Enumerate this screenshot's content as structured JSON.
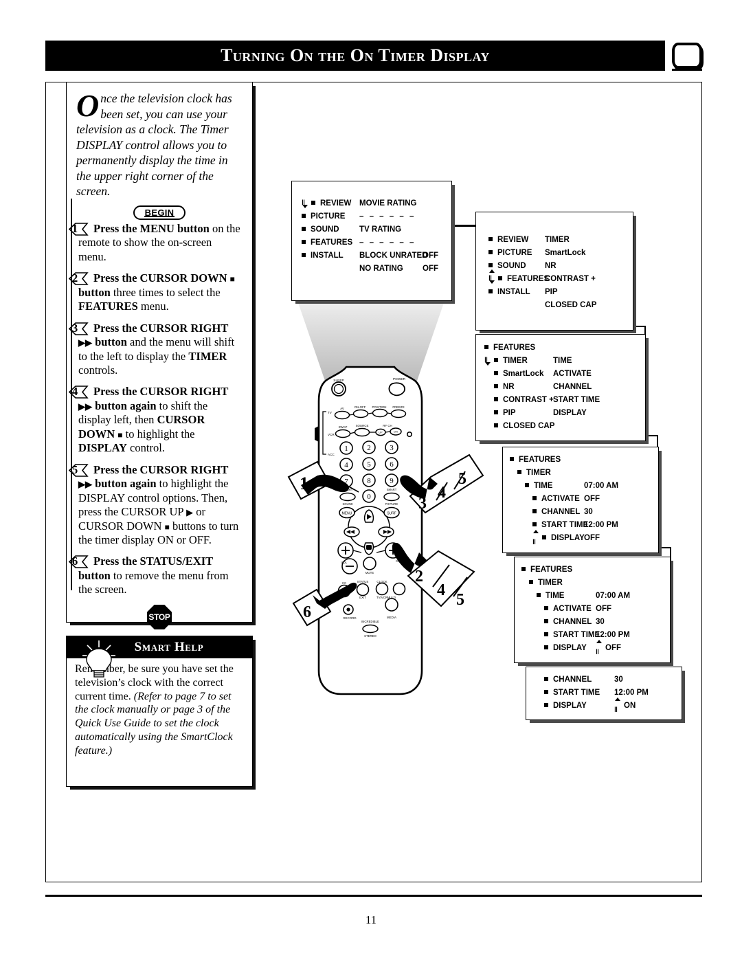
{
  "header": {
    "title": "Turning On the On Timer Display",
    "tv_icon": "tv-screen-icon"
  },
  "intro": {
    "dropcap": "O",
    "text": "nce the television clock has been set, you can use your television as a clock. The Timer DISPLAY control allows you to permanently display the time in the upper right corner of the screen."
  },
  "begin_label": "BEGIN",
  "stop_label": "STOP",
  "steps": [
    {
      "number": "1",
      "html": "<b>Press the MENU button</b> on the remote to show the on-screen menu."
    },
    {
      "number": "2",
      "html": "<b>Press the CURSOR DOWN <span class=\"sq\">■</span> button</b> three times to select the <b>FEATURES</b> menu."
    },
    {
      "number": "3",
      "html": "<b>Press the CURSOR RIGHT <span class=\"tri\">▶▶</span> button</b> and the menu will shift to the left to display the <b>TIMER</b> controls."
    },
    {
      "number": "4",
      "html": "<b>Press the CURSOR RIGHT <span class=\"tri\">▶▶</span> button again</b> to shift the display left, then <b>CURSOR DOWN <span class=\"sq\">■</span></b> to highlight the <b>DISPLAY</b> control."
    },
    {
      "number": "5",
      "html": "<b>Press the CURSOR RIGHT <span class=\"tri\">▶▶</span> button again</b> to highlight the DISPLAY control options. Then, press the CURSOR UP <span class=\"tri\">▶</span> or CURSOR DOWN <span class=\"sq\">■</span> buttons to turn the timer display ON or OFF."
    },
    {
      "number": "6",
      "html": "<b>Press the STATUS/EXIT button</b> to remove the menu from the screen."
    }
  ],
  "smart_help": {
    "title": "Smart Help",
    "body_html": "Remember, be sure you have set the television&rsquo;s clock with the correct current time. <span class=\"ital\">(Refer to page 7 to set the clock manually or page 3 of the Quick Use Guide to set the clock automatically using the SmartClock feature.)</span>"
  },
  "osd_panels": [
    {
      "id": "panel-1",
      "rows": [
        {
          "cursor": "down",
          "label": "REVIEW",
          "value": "MOVIE RATING",
          "value2": ""
        },
        {
          "cursor": "",
          "label": "PICTURE",
          "value": "– – – – – –",
          "value2": ""
        },
        {
          "cursor": "",
          "label": "SOUND",
          "value": "TV RATING",
          "value2": ""
        },
        {
          "cursor": "",
          "label": "FEATURES",
          "value": "– – – – – –",
          "value2": ""
        },
        {
          "cursor": "",
          "label": "INSTALL",
          "value": "BLOCK UNRATED",
          "value2": "OFF"
        },
        {
          "cursor": "",
          "label": "",
          "value": "NO RATING",
          "value2": "OFF"
        }
      ]
    },
    {
      "id": "panel-2",
      "rows": [
        {
          "cursor": "",
          "label": "REVIEW",
          "value": "TIMER"
        },
        {
          "cursor": "",
          "label": "PICTURE",
          "value": "SmartLock"
        },
        {
          "cursor": "",
          "label": "SOUND",
          "value": "NR"
        },
        {
          "cursor": "updown",
          "label": "FEATURES",
          "value": "CONTRAST +"
        },
        {
          "cursor": "",
          "label": "INSTALL",
          "value": "PIP"
        },
        {
          "cursor": "",
          "label": "",
          "value": "CLOSED CAP"
        }
      ]
    },
    {
      "id": "panel-3",
      "rows": [
        {
          "indent": 0,
          "cursor": "",
          "label": "FEATURES",
          "value": ""
        },
        {
          "indent": 0,
          "cursor": "down",
          "label": "TIMER",
          "value": "TIME"
        },
        {
          "indent": 1,
          "cursor": "",
          "label": "SmartLock",
          "value": "ACTIVATE"
        },
        {
          "indent": 1,
          "cursor": "",
          "label": "NR",
          "value": "CHANNEL"
        },
        {
          "indent": 1,
          "cursor": "",
          "label": "CONTRAST +",
          "value": "START TIME"
        },
        {
          "indent": 1,
          "cursor": "",
          "label": "PIP",
          "value": "DISPLAY"
        },
        {
          "indent": 1,
          "cursor": "",
          "label": "CLOSED CAP",
          "value": ""
        }
      ]
    },
    {
      "id": "panel-4",
      "rows": [
        {
          "indent": 0,
          "label": "FEATURES",
          "value": ""
        },
        {
          "indent": 1,
          "label": "TIMER",
          "value": ""
        },
        {
          "indent": 2,
          "label": "TIME",
          "value": "07:00 AM"
        },
        {
          "indent": 3,
          "label": "ACTIVATE",
          "value": "OFF"
        },
        {
          "indent": 3,
          "label": "CHANNEL",
          "value": "30"
        },
        {
          "indent": 3,
          "label": "START TIME",
          "value": "12:00 PM"
        },
        {
          "indent": 3,
          "label": "DISPLAY",
          "value": "OFF",
          "cursor": "up"
        }
      ]
    },
    {
      "id": "panel-5",
      "rows": [
        {
          "indent": 0,
          "label": "FEATURES",
          "value": ""
        },
        {
          "indent": 1,
          "label": "TIMER",
          "value": ""
        },
        {
          "indent": 2,
          "label": "TIME",
          "value": "07:00 AM"
        },
        {
          "indent": 3,
          "label": "ACTIVATE",
          "value": "OFF"
        },
        {
          "indent": 3,
          "label": "CHANNEL",
          "value": "30"
        },
        {
          "indent": 3,
          "label": "START TIME",
          "value": "12:00 PM"
        },
        {
          "indent": 3,
          "label": "DISPLAY",
          "value": "OFF",
          "value_cursor": true
        }
      ]
    },
    {
      "id": "panel-6",
      "rows": [
        {
          "indent": 0,
          "label": "CHANNEL",
          "value": "30"
        },
        {
          "indent": 0,
          "label": "START TIME",
          "value": "12:00 PM"
        },
        {
          "indent": 0,
          "label": "DISPLAY",
          "value": "ON",
          "value_cursor": true
        }
      ]
    }
  ],
  "remote": {
    "buttons": {
      "sleep": "SLEEP",
      "power": "POWER",
      "av": "AV",
      "onoff": "ON-OFF",
      "position": "POSITION",
      "freeze": "FREEZE",
      "swap": "SWAP",
      "source": "SOURCE",
      "rfch": "RF CH",
      "up": "UP",
      "dn": "DN",
      "tv": "TV",
      "vcr": "VCR",
      "acc": "ACC",
      "smart_sound": "SMART SOUND",
      "smart_picture": "SMART PICTURE",
      "menu": "MENU",
      "surf": "SURF",
      "vol": "VOL",
      "ch": "CH",
      "mute": "MUTE",
      "cc": "CC",
      "status_exit": "STATUS EXIT",
      "clock_tvvcr": "CLOCK TV/VCR",
      "record": "RECORD",
      "multi_media": "MULTI MEDIA",
      "incredible_stereo": "INCREDIBLE STEREO",
      "digits": [
        "1",
        "2",
        "3",
        "4",
        "5",
        "6",
        "7",
        "8",
        "9",
        "0"
      ]
    }
  },
  "callouts": {
    "left_single": "1",
    "right_345": [
      "3",
      "4",
      "5"
    ],
    "right_245": [
      "2",
      "4",
      "5"
    ],
    "left_6": "6"
  },
  "footer": {
    "page_number": "11"
  }
}
